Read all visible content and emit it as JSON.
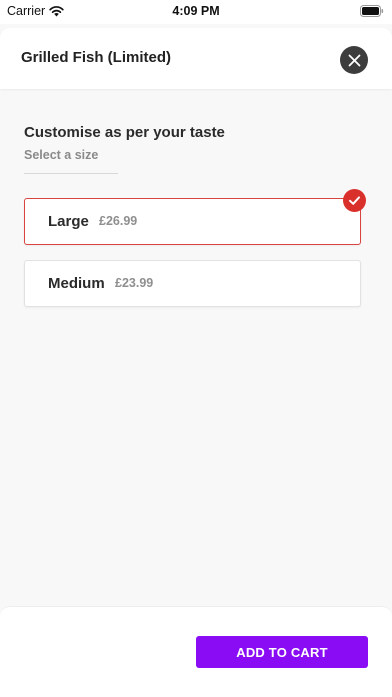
{
  "status_bar": {
    "carrier": "Carrier",
    "time": "4:09 PM",
    "icons": [
      "wifi-icon",
      "battery-icon"
    ]
  },
  "header": {
    "title": "Grilled Fish (Limited)",
    "close_icon": "close-icon"
  },
  "customise": {
    "title": "Customise as per your taste",
    "subtitle": "Select a size"
  },
  "options": [
    {
      "name": "Large",
      "price": "£26.99",
      "selected": true
    },
    {
      "name": "Medium",
      "price": "£23.99",
      "selected": false
    }
  ],
  "footer": {
    "add_to_cart_label": "ADD TO CART"
  },
  "colors": {
    "accent": "#8a0cf5",
    "selected_border": "#d9443f",
    "check_badge": "#d9302c",
    "close_button": "#3d3d3d"
  }
}
